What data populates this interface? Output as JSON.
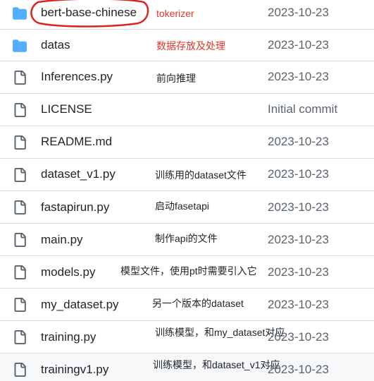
{
  "files": [
    {
      "name": "bert-base-chinese",
      "type": "folder",
      "note": "tokerizer",
      "date": "2023-10-23"
    },
    {
      "name": "datas",
      "type": "folder",
      "note": "数据存放及处理",
      "date": "2023-10-23"
    },
    {
      "name": "Inferences.py",
      "type": "file",
      "note": "前向推理",
      "date": "2023-10-23"
    },
    {
      "name": "LICENSE",
      "type": "file",
      "note": "",
      "date": "Initial commit"
    },
    {
      "name": "README.md",
      "type": "file",
      "note": "",
      "date": "2023-10-23"
    },
    {
      "name": "dataset_v1.py",
      "type": "file",
      "note": "训练用的dataset文件",
      "date": "2023-10-23"
    },
    {
      "name": "fastapirun.py",
      "type": "file",
      "note": "启动fasetapi",
      "date": "2023-10-23"
    },
    {
      "name": "main.py",
      "type": "file",
      "note": "制作api的文件",
      "date": "2023-10-23"
    },
    {
      "name": "models.py",
      "type": "file",
      "note": "模型文件，使用pt时需要引入它",
      "date": "2023-10-23"
    },
    {
      "name": "my_dataset.py",
      "type": "file",
      "note": "另一个版本的dataset",
      "date": "2023-10-23"
    },
    {
      "name": "training.py",
      "type": "file",
      "note": "训练模型，和my_dataset对应",
      "date": "2023-10-23"
    },
    {
      "name": "trainingv1.py",
      "type": "file",
      "note": "训练模型，和dataset_v1对应",
      "date": "2023-10-23"
    }
  ],
  "colors": {
    "folder_icon": "#54aeff",
    "file_icon": "#59636e",
    "annotation_red": "#e0342f"
  }
}
